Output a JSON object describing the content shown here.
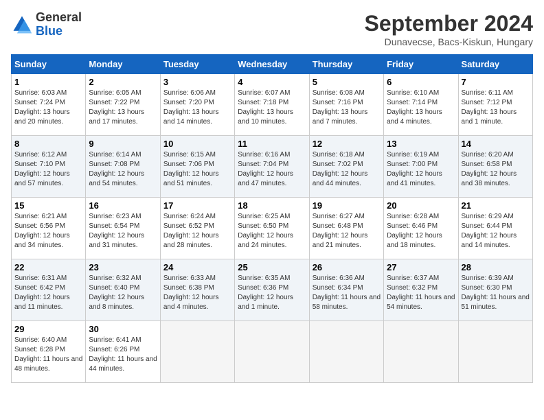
{
  "header": {
    "logo_general": "General",
    "logo_blue": "Blue",
    "month_year": "September 2024",
    "location": "Dunavecse, Bacs-Kiskun, Hungary"
  },
  "days_of_week": [
    "Sunday",
    "Monday",
    "Tuesday",
    "Wednesday",
    "Thursday",
    "Friday",
    "Saturday"
  ],
  "weeks": [
    [
      {
        "day": "1",
        "info": "Sunrise: 6:03 AM\nSunset: 7:24 PM\nDaylight: 13 hours and 20 minutes."
      },
      {
        "day": "2",
        "info": "Sunrise: 6:05 AM\nSunset: 7:22 PM\nDaylight: 13 hours and 17 minutes."
      },
      {
        "day": "3",
        "info": "Sunrise: 6:06 AM\nSunset: 7:20 PM\nDaylight: 13 hours and 14 minutes."
      },
      {
        "day": "4",
        "info": "Sunrise: 6:07 AM\nSunset: 7:18 PM\nDaylight: 13 hours and 10 minutes."
      },
      {
        "day": "5",
        "info": "Sunrise: 6:08 AM\nSunset: 7:16 PM\nDaylight: 13 hours and 7 minutes."
      },
      {
        "day": "6",
        "info": "Sunrise: 6:10 AM\nSunset: 7:14 PM\nDaylight: 13 hours and 4 minutes."
      },
      {
        "day": "7",
        "info": "Sunrise: 6:11 AM\nSunset: 7:12 PM\nDaylight: 13 hours and 1 minute."
      }
    ],
    [
      {
        "day": "8",
        "info": "Sunrise: 6:12 AM\nSunset: 7:10 PM\nDaylight: 12 hours and 57 minutes."
      },
      {
        "day": "9",
        "info": "Sunrise: 6:14 AM\nSunset: 7:08 PM\nDaylight: 12 hours and 54 minutes."
      },
      {
        "day": "10",
        "info": "Sunrise: 6:15 AM\nSunset: 7:06 PM\nDaylight: 12 hours and 51 minutes."
      },
      {
        "day": "11",
        "info": "Sunrise: 6:16 AM\nSunset: 7:04 PM\nDaylight: 12 hours and 47 minutes."
      },
      {
        "day": "12",
        "info": "Sunrise: 6:18 AM\nSunset: 7:02 PM\nDaylight: 12 hours and 44 minutes."
      },
      {
        "day": "13",
        "info": "Sunrise: 6:19 AM\nSunset: 7:00 PM\nDaylight: 12 hours and 41 minutes."
      },
      {
        "day": "14",
        "info": "Sunrise: 6:20 AM\nSunset: 6:58 PM\nDaylight: 12 hours and 38 minutes."
      }
    ],
    [
      {
        "day": "15",
        "info": "Sunrise: 6:21 AM\nSunset: 6:56 PM\nDaylight: 12 hours and 34 minutes."
      },
      {
        "day": "16",
        "info": "Sunrise: 6:23 AM\nSunset: 6:54 PM\nDaylight: 12 hours and 31 minutes."
      },
      {
        "day": "17",
        "info": "Sunrise: 6:24 AM\nSunset: 6:52 PM\nDaylight: 12 hours and 28 minutes."
      },
      {
        "day": "18",
        "info": "Sunrise: 6:25 AM\nSunset: 6:50 PM\nDaylight: 12 hours and 24 minutes."
      },
      {
        "day": "19",
        "info": "Sunrise: 6:27 AM\nSunset: 6:48 PM\nDaylight: 12 hours and 21 minutes."
      },
      {
        "day": "20",
        "info": "Sunrise: 6:28 AM\nSunset: 6:46 PM\nDaylight: 12 hours and 18 minutes."
      },
      {
        "day": "21",
        "info": "Sunrise: 6:29 AM\nSunset: 6:44 PM\nDaylight: 12 hours and 14 minutes."
      }
    ],
    [
      {
        "day": "22",
        "info": "Sunrise: 6:31 AM\nSunset: 6:42 PM\nDaylight: 12 hours and 11 minutes."
      },
      {
        "day": "23",
        "info": "Sunrise: 6:32 AM\nSunset: 6:40 PM\nDaylight: 12 hours and 8 minutes."
      },
      {
        "day": "24",
        "info": "Sunrise: 6:33 AM\nSunset: 6:38 PM\nDaylight: 12 hours and 4 minutes."
      },
      {
        "day": "25",
        "info": "Sunrise: 6:35 AM\nSunset: 6:36 PM\nDaylight: 12 hours and 1 minute."
      },
      {
        "day": "26",
        "info": "Sunrise: 6:36 AM\nSunset: 6:34 PM\nDaylight: 11 hours and 58 minutes."
      },
      {
        "day": "27",
        "info": "Sunrise: 6:37 AM\nSunset: 6:32 PM\nDaylight: 11 hours and 54 minutes."
      },
      {
        "day": "28",
        "info": "Sunrise: 6:39 AM\nSunset: 6:30 PM\nDaylight: 11 hours and 51 minutes."
      }
    ],
    [
      {
        "day": "29",
        "info": "Sunrise: 6:40 AM\nSunset: 6:28 PM\nDaylight: 11 hours and 48 minutes."
      },
      {
        "day": "30",
        "info": "Sunrise: 6:41 AM\nSunset: 6:26 PM\nDaylight: 11 hours and 44 minutes."
      },
      null,
      null,
      null,
      null,
      null
    ]
  ]
}
